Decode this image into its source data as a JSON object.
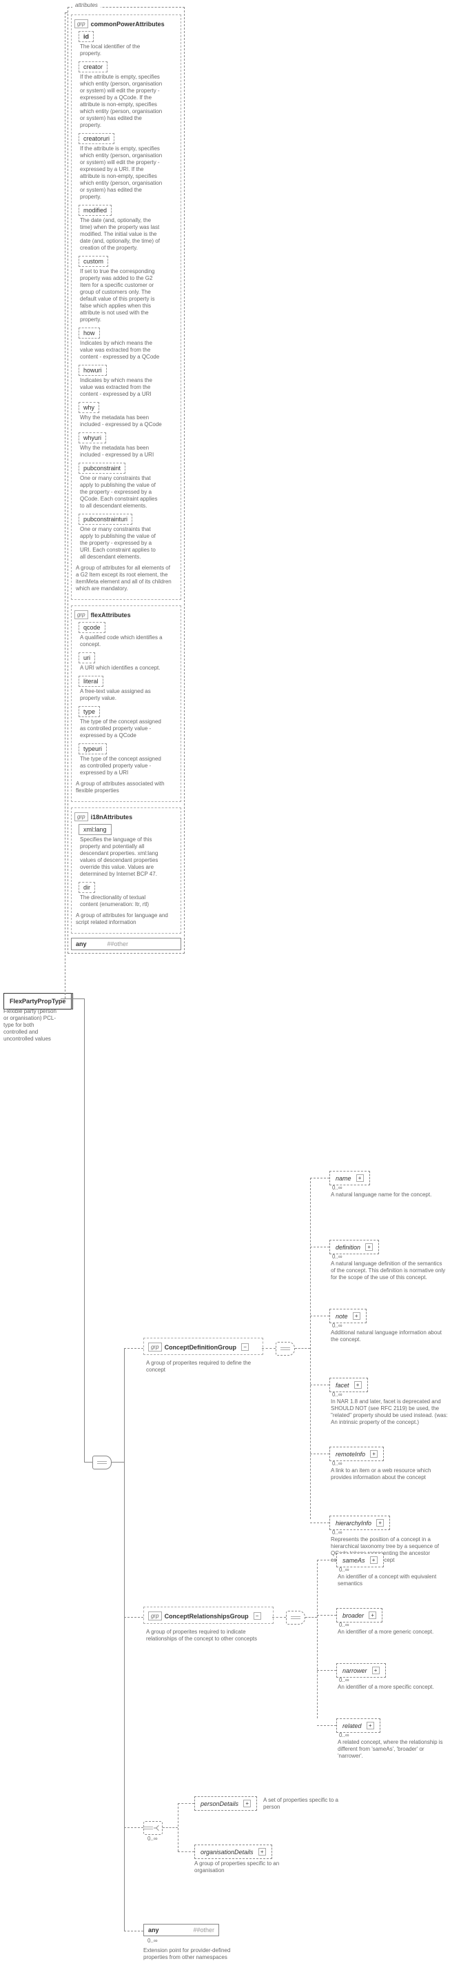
{
  "root": {
    "name": "FlexPartyPropType",
    "desc": "Flexible party (person or organisation) PCL-type for both controlled and uncontrolled values"
  },
  "attributesLabel": "attributes",
  "grpLabel": "grp",
  "anyOther": {
    "any": "any",
    "other": "##other"
  },
  "cardinality": {
    "zeroInf": "0..∞"
  },
  "groupA": {
    "title": "commonPowerAttributes",
    "desc": "A group of attributes for all elements of a G2 Item except its root element, the itemMeta element and all of its children which are mandatory.",
    "items": [
      {
        "name": "id",
        "bold": true,
        "desc": "The local identifier of the property."
      },
      {
        "name": "creator",
        "desc": "If the attribute is empty, specifies which entity (person, organisation or system) will edit the property - expressed by a QCode. If the attribute is non-empty, specifies which entity (person, organisation or system) has edited the property."
      },
      {
        "name": "creatoruri",
        "desc": "If the attribute is empty, specifies which entity (person, organisation or system) will edit the property - expressed by a URI. If the attribute is non-empty, specifies which entity (person, organisation or system) has edited the property."
      },
      {
        "name": "modified",
        "desc": "The date (and, optionally, the time) when the property was last modified. The initial value is the date (and, optionally, the time) of creation of the property."
      },
      {
        "name": "custom",
        "desc": "If set to true the corresponding property was added to the G2 Item for a specific customer or group of customers only. The default value of this property is false which applies when this attribute is not used with the property."
      },
      {
        "name": "how",
        "desc": "Indicates by which means the value was extracted from the content - expressed by a QCode"
      },
      {
        "name": "howuri",
        "desc": "Indicates by which means the value was extracted from the content - expressed by a URI"
      },
      {
        "name": "why",
        "desc": "Why the metadata has been included - expressed by a QCode"
      },
      {
        "name": "whyuri",
        "desc": "Why the metadata has been included - expressed by a URI"
      },
      {
        "name": "pubconstraint",
        "desc": "One or many constraints that apply to publishing the value of the property - expressed by a QCode. Each constraint applies to all descendant elements."
      },
      {
        "name": "pubconstrainturi",
        "desc": "One or many constraints that apply to publishing the value of the property - expressed by a URI. Each constraint applies to all descendant elements."
      }
    ]
  },
  "groupB": {
    "title": "flexAttributes",
    "desc": "A group of attributes associated with flexible properties",
    "items": [
      {
        "name": "qcode",
        "desc": "A qualified code which identifies a concept."
      },
      {
        "name": "uri",
        "desc": "A URI which identifies a concept."
      },
      {
        "name": "literal",
        "desc": "A free-text value assigned as property value."
      },
      {
        "name": "type",
        "desc": "The type of the concept assigned as controlled property value - expressed by a QCode"
      },
      {
        "name": "typeuri",
        "desc": "The type of the concept assigned as controlled property value - expressed by a URI"
      }
    ]
  },
  "groupC": {
    "title": "i18nAttributes",
    "desc": "A group of attributes for language and script related information",
    "items": [
      {
        "name": "xml:lang",
        "solid": true,
        "desc": "Specifies the language of this property and potentially all descendant properties. xml:lang values of descendant properties override this value. Values are determined by Internet BCP 47."
      },
      {
        "name": "dir",
        "desc": "The directionality of textual content (enumeration: ltr, rtl)"
      }
    ]
  },
  "defGroup": {
    "name": "ConceptDefinitionGroup",
    "desc": "A group of properites required to define the concept",
    "items": [
      {
        "name": "name",
        "desc": "A natural language name for the concept."
      },
      {
        "name": "definition",
        "desc": "A natural language definition of the semantics of the concept. This definition is normative only for the scope of the use of this concept."
      },
      {
        "name": "note",
        "desc": "Additional natural language information about the concept."
      },
      {
        "name": "facet",
        "desc": "In NAR 1.8 and later, facet is deprecated and SHOULD NOT (see RFC 2119) be used, the \"related\" property should be used instead. (was: An intrinsic property of the concept.)"
      },
      {
        "name": "remoteInfo",
        "desc": "A link to an item or a web resource which provides information about the concept"
      },
      {
        "name": "hierarchyInfo",
        "desc": "Represents the position of a concept in a hierarchical taxonomy tree by a sequence of QCode tokens representing the ancestor concepts and this concept"
      }
    ]
  },
  "relGroup": {
    "name": "ConceptRelationshipsGroup",
    "desc": "A group of properites required to indicate relationships of the concept to other concepts",
    "items": [
      {
        "name": "sameAs",
        "desc": "An identifier of a concept with equivalent semantics"
      },
      {
        "name": "broader",
        "desc": "An identifier of a more generic concept."
      },
      {
        "name": "narrower",
        "desc": "An identifier of a more specific concept."
      },
      {
        "name": "related",
        "desc": "A related concept, where the relationship is different from 'sameAs', 'broader' or 'narrower'."
      }
    ]
  },
  "choice": {
    "personDetails": {
      "name": "personDetails",
      "desc": "A set of properties specific to a person"
    },
    "organisationDetails": {
      "name": "organisationDetails",
      "desc": "A group of properties specific to an organisation"
    }
  },
  "extDesc": "Extension point for provider-defined properties from other namespaces"
}
